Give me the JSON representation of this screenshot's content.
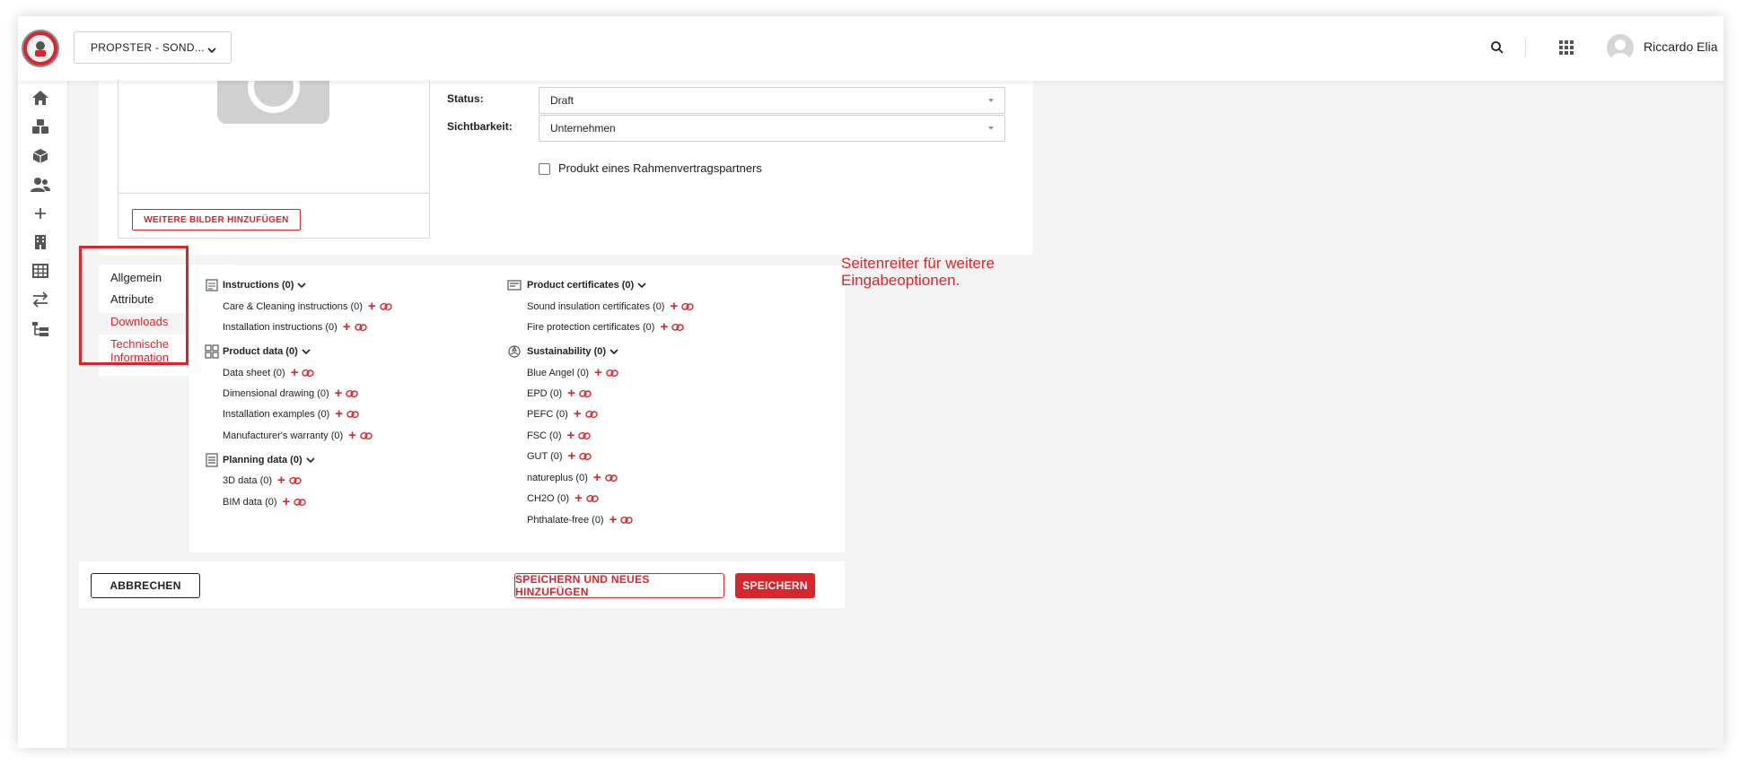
{
  "header": {
    "project_selector": "PROPSTER - SOND...",
    "user_name": "Riccardo Elia"
  },
  "sidebar": {
    "icons": [
      "home-icon",
      "boxes-icon",
      "cube-icon",
      "users-icon",
      "plus-icon",
      "building-icon",
      "table-icon",
      "transfer-icon",
      "hierarchy-icon"
    ]
  },
  "image_panel": {
    "add_images_button": "WEITERE BILDER HINZUFÜGEN"
  },
  "form": {
    "status_label": "Status:",
    "status_value": "Draft",
    "visibility_label": "Sichtbarkeit:",
    "visibility_value": "Unternehmen",
    "framework_partner_label": "Produkt eines Rahmenvertragspartners"
  },
  "tabs": {
    "items": [
      {
        "label": "Allgemein"
      },
      {
        "label": "Attribute"
      },
      {
        "label": "Downloads"
      },
      {
        "label": "Technische Information"
      }
    ]
  },
  "downloads": {
    "instructions": {
      "title": "Instructions (0)",
      "items": [
        "Care & Cleaning instructions (0)",
        "Installation instructions (0)"
      ]
    },
    "product_data": {
      "title": "Product data (0)",
      "items": [
        "Data sheet (0)",
        "Dimensional drawing (0)",
        "Installation examples (0)",
        "Manufacturer's warranty (0)"
      ]
    },
    "planning_data": {
      "title": "Planning data (0)",
      "items": [
        "3D data (0)",
        "BIM data (0)"
      ]
    },
    "product_certificates": {
      "title": "Product certificates (0)",
      "items": [
        "Sound insulation certificates (0)",
        "Fire protection certificates (0)"
      ]
    },
    "sustainability": {
      "title": "Sustainability (0)",
      "items": [
        "Blue Angel (0)",
        "EPD (0)",
        "PEFC (0)",
        "FSC (0)",
        "GUT (0)",
        "natureplus (0)",
        "CH2O (0)",
        "Phthalate-free (0)"
      ]
    }
  },
  "annotation": "Seitenreiter für weitere Eingabeoptionen.",
  "footer": {
    "cancel": "ABBRECHEN",
    "save_and_new": "SPEICHERN UND NEUES HINZUFÜGEN",
    "save": "SPEICHERN"
  },
  "colors": {
    "accent": "#d8262c",
    "background": "#f4f4f4"
  }
}
